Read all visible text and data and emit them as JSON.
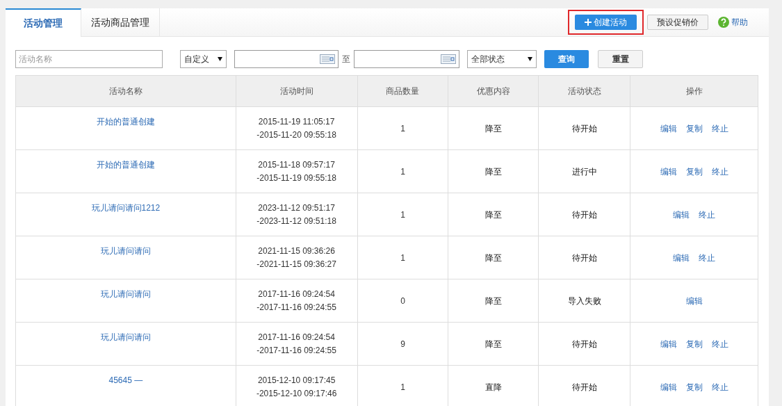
{
  "tabs": [
    {
      "label": "活动管理",
      "selected": true
    },
    {
      "label": "活动商品管理",
      "selected": false
    }
  ],
  "header_actions": {
    "create_button": "创建活动",
    "preset_button": "预设促销价",
    "help_link": "帮助"
  },
  "filters": {
    "name_placeholder": "活动名称",
    "range_select": "自定义",
    "to_label": "至",
    "status_select": "全部状态",
    "query_button": "查询",
    "reset_button": "重置"
  },
  "table": {
    "columns": [
      "活动名称",
      "活动时间",
      "商品数量",
      "优惠内容",
      "活动状态",
      "操作"
    ],
    "rows": [
      {
        "name": "开始的普通创建",
        "start": "2015-11-19 11:05:17",
        "end": "-2015-11-20 09:55:18",
        "count": "1",
        "discount": "降至",
        "status": "待开始",
        "actions": [
          "编辑",
          "复制",
          "终止"
        ]
      },
      {
        "name": "开始的普通创建",
        "start": "2015-11-18 09:57:17",
        "end": "-2015-11-19 09:55:18",
        "count": "1",
        "discount": "降至",
        "status": "进行中",
        "actions": [
          "编辑",
          "复制",
          "终止"
        ]
      },
      {
        "name": "玩儿请问请问1212",
        "start": "2023-11-12 09:51:17",
        "end": "-2023-11-12 09:51:18",
        "count": "1",
        "discount": "降至",
        "status": "待开始",
        "actions": [
          "编辑",
          "终止"
        ]
      },
      {
        "name": "玩儿请问请问",
        "start": "2021-11-15 09:36:26",
        "end": "-2021-11-15 09:36:27",
        "count": "1",
        "discount": "降至",
        "status": "待开始",
        "actions": [
          "编辑",
          "终止"
        ]
      },
      {
        "name": "玩儿请问请问",
        "start": "2017-11-16 09:24:54",
        "end": "-2017-11-16 09:24:55",
        "count": "0",
        "discount": "降至",
        "status": "导入失败",
        "actions": [
          "编辑"
        ]
      },
      {
        "name": "玩儿请问请问",
        "start": "2017-11-16 09:24:54",
        "end": "-2017-11-16 09:24:55",
        "count": "9",
        "discount": "降至",
        "status": "待开始",
        "actions": [
          "编辑",
          "复制",
          "终止"
        ]
      },
      {
        "name": "45645 —",
        "start": "2015-12-10 09:17:45",
        "end": "-2015-12-10 09:17:46",
        "count": "1",
        "discount": "直降",
        "status": "待开始",
        "actions": [
          "编辑",
          "复制",
          "终止"
        ]
      }
    ]
  }
}
